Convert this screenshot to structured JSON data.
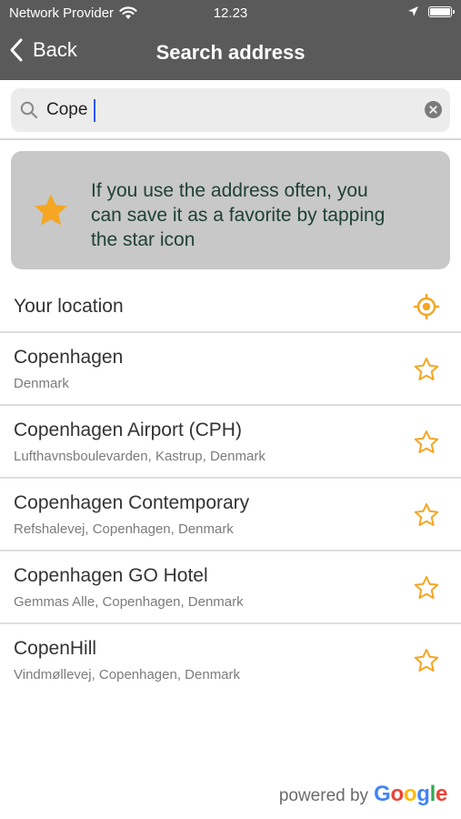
{
  "status_bar": {
    "carrier": "Network Provider",
    "time": "12.23"
  },
  "nav": {
    "back_label": "Back",
    "title": "Search address"
  },
  "search": {
    "value": "Cope"
  },
  "tip": {
    "text": "If you use the address often, you can save it as a favorite by tapping the star icon"
  },
  "current_location": {
    "label": "Your location"
  },
  "results": [
    {
      "name": "Copenhagen",
      "detail": "Denmark"
    },
    {
      "name": "Copenhagen Airport (CPH)",
      "detail": "Lufthavnsboulevarden, Kastrup, Denmark"
    },
    {
      "name": "Copenhagen Contemporary",
      "detail": "Refshalevej, Copenhagen, Denmark"
    },
    {
      "name": "Copenhagen GO Hotel",
      "detail": "Gemmas Alle, Copenhagen, Denmark"
    },
    {
      "name": "CopenHill",
      "detail": "Vindmøllevej, Copenhagen, Denmark"
    }
  ],
  "footer": {
    "powered_by": "powered by",
    "brand_letters": [
      "G",
      "o",
      "o",
      "g",
      "l",
      "e"
    ]
  },
  "icons": {
    "search": "magnifier-icon",
    "clear": "clear-circle-icon",
    "favorite": "star-outline-icon",
    "tip": "star-filled-icon",
    "location": "crosshair-icon"
  },
  "colors": {
    "nav_bg": "#5a5a5a",
    "accent_orange": "#f5a623",
    "tip_bg": "#c8c8c8",
    "tip_text": "#1f4035",
    "cursor_blue": "#2b57ff",
    "brand_blue": "#4285F4",
    "brand_red": "#EA4335",
    "brand_yellow": "#FBBC05",
    "brand_green": "#34A853"
  }
}
